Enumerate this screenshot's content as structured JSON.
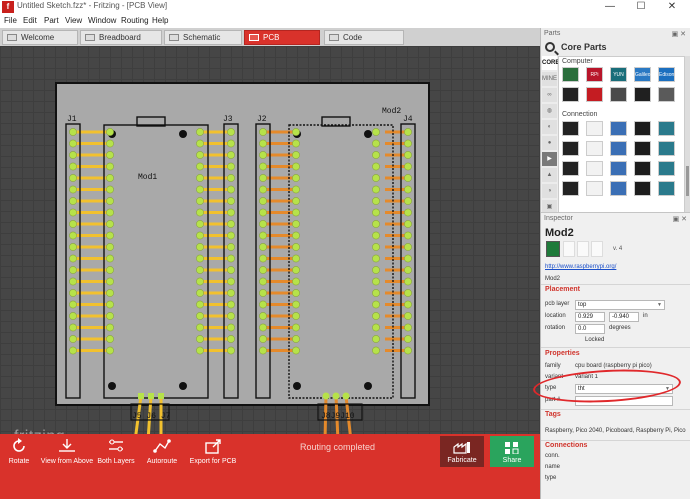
{
  "window": {
    "title": "Untitled Sketch.fzz* - Fritzing - [PCB View]",
    "app_icon_letter": "f",
    "controls": [
      "—",
      "☐",
      "✕"
    ]
  },
  "menu": [
    "File",
    "Edit",
    "Part",
    "View",
    "Window",
    "Routing",
    "Help"
  ],
  "tabs": [
    {
      "label": "Welcome",
      "active": false
    },
    {
      "label": "Breadboard",
      "active": false
    },
    {
      "label": "Schematic",
      "active": false
    },
    {
      "label": "PCB",
      "active": true
    },
    {
      "label": "Code",
      "active": false
    }
  ],
  "canvas": {
    "parts": {
      "mod1": "Mod1",
      "mod2": "Mod2",
      "j1": "J1",
      "j2": "J2",
      "j3": "J3",
      "j4": "J4",
      "j5_j7": "J5 J6 J7",
      "j8_j10": "J8J9J10"
    },
    "watermark": "fritzing",
    "colors": {
      "board": "#a8a8a8",
      "pad": "#b6e24a",
      "trace_top": "#f2c12e",
      "trace_bottom": "#e58a2b"
    }
  },
  "toolbar": {
    "rotate": "Rotate",
    "view_from_above": "View from Above",
    "both_layers": "Both Layers",
    "autoroute": "Autoroute",
    "export_for_pcb": "Export for PCB",
    "status": "Routing completed",
    "fabricate": "Fabricate",
    "share": "Share"
  },
  "parts_panel": {
    "title": "Parts",
    "heading": "Core Parts",
    "bins": [
      "CORE",
      "MINE",
      "",
      "",
      "",
      "",
      "",
      "",
      "",
      "",
      ""
    ],
    "categories": {
      "computer": "Computer",
      "connection": "Connection"
    },
    "computer_tiles": [
      "",
      "RPi",
      "YUN",
      "Galileo",
      "Edison",
      "",
      "",
      "",
      "",
      ""
    ],
    "tile_colors": [
      "#2a6e3c",
      "#b8152a",
      "#196e7a",
      "#2a79c3",
      "#1b6fbf",
      "#232323",
      "#c41c22",
      "#4a4a4a",
      "#202020",
      "#5a5a5a"
    ]
  },
  "inspector": {
    "panel_title": "Inspector",
    "part_title": "Mod2",
    "version": "v. 4",
    "link": "http://www.raspberrypi.org/",
    "instance": "Mod2",
    "placement": {
      "heading": "Placement",
      "pcb_layer_label": "pcb layer",
      "pcb_layer_value": "top",
      "location_label": "location",
      "location_x": "0.929",
      "location_y": "-0.940",
      "location_unit": "in",
      "rotation_label": "rotation",
      "rotation_value": "0.0",
      "rotation_unit": "degrees",
      "locked_label": "Locked"
    },
    "properties": {
      "heading": "Properties",
      "family_label": "family",
      "family_value": "cpu board (raspberry pi pico)",
      "variant_label": "variant",
      "variant_value": "variant 1",
      "type_label": "type",
      "type_value": "tht",
      "part_label": "part #",
      "part_value": ""
    },
    "tags": {
      "heading": "Tags",
      "value": "Raspberry, Pico 2040, Picoboard, Raspberry Pi, Pico"
    },
    "connections": {
      "heading": "Connections",
      "conn_label": "conn.",
      "name_label": "name",
      "type_label": "type"
    }
  }
}
